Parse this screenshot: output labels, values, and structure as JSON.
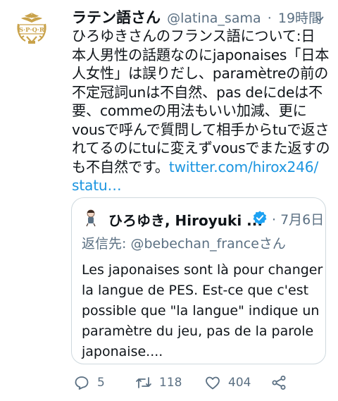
{
  "author": {
    "display_name": "ラテン語さん",
    "handle": "@latina_sama",
    "separator": "·",
    "time": "19時間",
    "avatar_text": "S·P·Q·R"
  },
  "tweet": {
    "lines": [
      "ひろゆきさんのフランス語について:日",
      "本人男性の話題なのにjaponaises「日本",
      "人女性」は誤りだし、paramètreの前の",
      "不定冠詞unは不自然、pas deにdeは不",
      "要、commeの用法もいい加減、更に",
      "vousで呼んで質問して相手からtuで返さ",
      "れてるのにtuに変えずvousでまた返すの",
      "も不自然です。"
    ],
    "link_part1": "twitter.com/hirox246/",
    "link_part2": "statu…"
  },
  "quoted_tweet": {
    "display_name": "ひろゆき, Hiroyuki ...",
    "separator": "·",
    "date": "7月6日",
    "reply_to": "返信先: @bebechan_franceさん",
    "text_lines": [
      "Les japonaises sont là pour changer",
      "la langue de PES. Est-ce que c'est",
      "possible que \"la langue\" indique un",
      "paramètre du jeu, pas de la parole",
      "japonaise...."
    ]
  },
  "actions": {
    "reply_count": "5",
    "retweet_count": "118",
    "like_count": "404"
  },
  "colors": {
    "link": "#1b95e0",
    "secondary_text": "#5b7083",
    "verified": "#1da1f2",
    "avatar_gold": "#c9a24a"
  },
  "icons": [
    "more-icon",
    "verified-icon",
    "reply-icon",
    "retweet-icon",
    "like-icon",
    "share-icon"
  ]
}
